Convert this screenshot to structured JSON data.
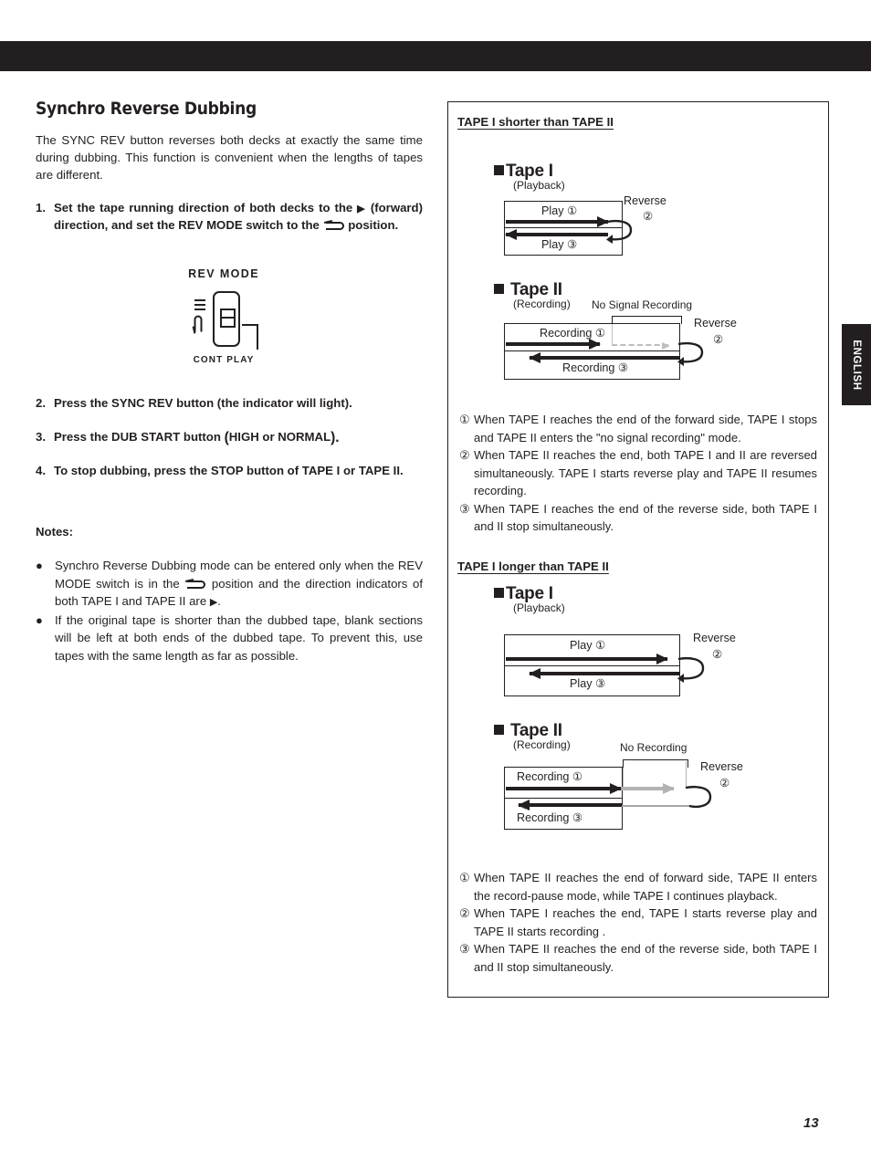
{
  "page": {
    "number": "13",
    "language_tab": "ENGLISH"
  },
  "left": {
    "title": "Synchro Reverse Dubbing",
    "intro": "The SYNC REV button reverses both decks at exactly the same time during dubbing. This function is convenient when the lengths of tapes are different.",
    "steps": [
      {
        "num": "1.",
        "part1": "Set the tape running direction of both decks to the ",
        "triangle": "▶",
        "part2": " (forward) direction, and set the REV MODE switch to the ",
        "part3": " position."
      },
      {
        "num": "2.",
        "text": "Press the SYNC REV button (the indicator will light)."
      },
      {
        "num": "3.",
        "text_a": "Press the DUB START button ",
        "text_b": "(",
        "text_c": "HIGH or NORMAL",
        "text_d": ")."
      },
      {
        "num": "4.",
        "text": "To stop dubbing, press the STOP button of TAPE I or TAPE II."
      }
    ],
    "revmode_diagram": {
      "label": "REV MODE",
      "cont_play": "CONT PLAY"
    },
    "notes_heading": "Notes:",
    "notes": [
      {
        "bullet": "●",
        "part1": "Synchro Reverse Dubbing mode can be entered only when the REV MODE switch is in the ",
        "part2": " position and the direction indicators of both TAPE I and TAPE II are ",
        "triangle": "▶",
        "part3": "."
      },
      {
        "bullet": "●",
        "text": "If the original tape is shorter than the dubbed tape, blank sections will be left at both ends of the dubbed tape. To prevent this, use tapes with the same length as far as possible."
      }
    ]
  },
  "right": {
    "section_a": {
      "title": "TAPE I shorter than TAPE II",
      "tape1": {
        "name": "Tape I",
        "sub": "(Playback)",
        "forward_label": "Play ①",
        "reverse_label": "Play ③",
        "reverse_title": "Reverse",
        "reverse_num": "②"
      },
      "tape2": {
        "name": "Tape II",
        "sub": "(Recording)",
        "span_label": "No Signal Recording",
        "forward_label": "Recording ①",
        "reverse_label": "Recording ③",
        "reverse_title": "Reverse",
        "reverse_num": "②"
      },
      "notes": [
        {
          "num": "①",
          "text": "When TAPE I reaches the end of the forward side, TAPE I stops and TAPE II enters the \"no signal recording\" mode."
        },
        {
          "num": "②",
          "text": "When TAPE II reaches the end, both TAPE I and II are reversed simultaneously. TAPE I starts reverse play and TAPE II resumes recording."
        },
        {
          "num": "③",
          "text": "When TAPE I reaches the end of the reverse side, both TAPE I and II stop simultaneously."
        }
      ]
    },
    "section_b": {
      "title": "TAPE I longer than TAPE II",
      "tape1": {
        "name": "Tape I",
        "sub": "(Playback)",
        "forward_label": "Play ①",
        "reverse_label": "Play ③",
        "reverse_title": "Reverse",
        "reverse_num": "②"
      },
      "tape2": {
        "name": "Tape II",
        "sub": "(Recording)",
        "span_label": "No Recording",
        "forward_label": "Recording ①",
        "reverse_label": "Recording ③",
        "reverse_title": "Reverse",
        "reverse_num": "②"
      },
      "notes": [
        {
          "num": "①",
          "text": "When TAPE II reaches the end of forward side, TAPE II enters the record-pause mode, while TAPE I continues playback."
        },
        {
          "num": "②",
          "text": "When TAPE I reaches the end, TAPE I starts reverse play and TAPE II starts recording ."
        },
        {
          "num": "③",
          "text": "When TAPE II reaches the end of the reverse side, both TAPE I and II stop simultaneously."
        }
      ]
    }
  },
  "colors": {
    "ink": "#231f20",
    "grey_arrow": "#b3b3b3",
    "dashed_arrow": "#bfbfbf"
  }
}
